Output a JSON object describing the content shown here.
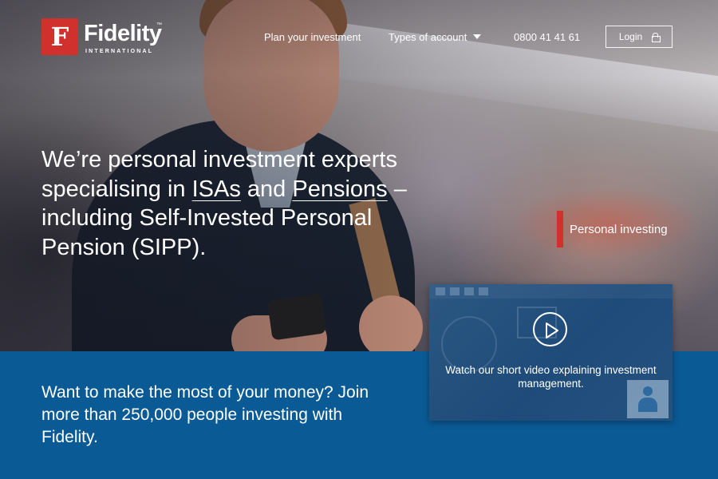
{
  "brand": {
    "logo_glyph": "F",
    "name": "Fidelity",
    "trademark": "™",
    "subtitle": "INTERNATIONAL",
    "color_red": "#d0312d"
  },
  "nav": {
    "plan_label": "Plan your investment",
    "types_label": "Types of account",
    "phone": "0800 41 41 61",
    "login_label": "Login"
  },
  "hero": {
    "headline_part1": "We’re personal investment experts specialising in ",
    "isas_link": "ISAs",
    "and_word": " and ",
    "pensions_link": "Pensions",
    "headline_part2": " – including Self-Invested Personal Pension (SIPP).",
    "tag_label": "Personal investing"
  },
  "video": {
    "caption": "Watch our short video explaining investment management."
  },
  "band": {
    "text": "Want to make the most of your money? Join more than 250,000 people investing with Fidelity.",
    "color": "#0a5a95"
  }
}
